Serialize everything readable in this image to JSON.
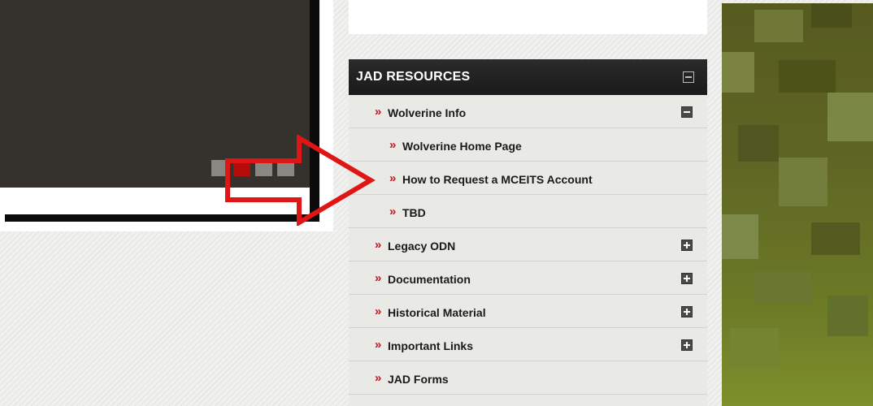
{
  "slideshow": {
    "dots": [
      {
        "state": "inactive"
      },
      {
        "state": "active"
      },
      {
        "state": "inactive"
      },
      {
        "state": "inactive"
      }
    ],
    "active_color": "#b50b0b"
  },
  "menu": {
    "title": "JAD RESOURCES",
    "chevron": "»",
    "items": [
      {
        "label": "Wolverine Info",
        "level": 1,
        "toggle": "minus"
      },
      {
        "label": "Wolverine Home Page",
        "level": 2
      },
      {
        "label": "How to Request a MCEITS Account",
        "level": 2
      },
      {
        "label": "TBD",
        "level": 2
      },
      {
        "label": "Legacy ODN",
        "level": 1,
        "toggle": "plus"
      },
      {
        "label": "Documentation",
        "level": 1,
        "toggle": "plus"
      },
      {
        "label": "Historical Material",
        "level": 1,
        "toggle": "plus"
      },
      {
        "label": "Important Links",
        "level": 1,
        "toggle": "plus"
      },
      {
        "label": "JAD Forms",
        "level": 1
      }
    ]
  },
  "colors": {
    "accent_red": "#c4161c",
    "header_bg": "#1f1f1f",
    "camo": "#5f6624"
  }
}
